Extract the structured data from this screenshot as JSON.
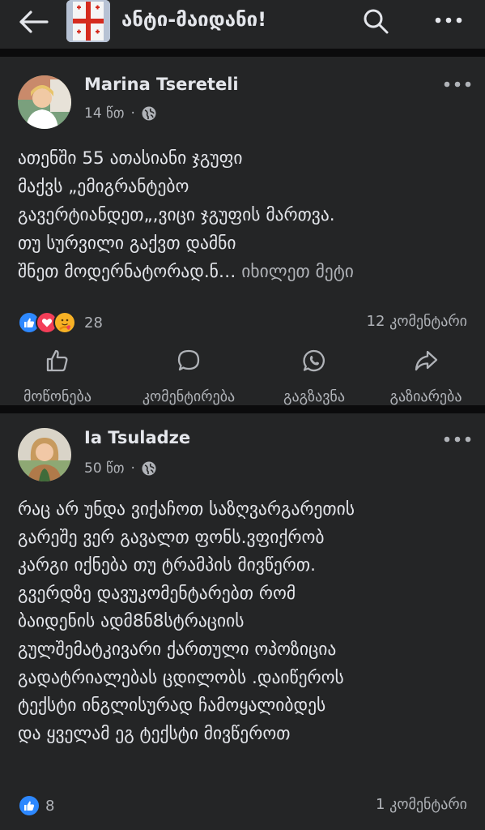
{
  "header": {
    "group_title": "ანტი-მაიდანი!",
    "back_icon": "arrow-left-icon",
    "search_icon": "search-icon",
    "more_icon": "more-horizontal-icon"
  },
  "posts": [
    {
      "author": "Marina Tsereteli",
      "time": "14 წთ",
      "visibility_icon": "globe-icon",
      "text": "ათენში 55 ათასიანი ჯგუფი\nმაქვს „ემიგრანტებო\nგავერტიანდეთ„,ვიცი ჯგუფის მართვა.\nთუ სურვილი გაქვთ დამნი\nშნეთ მოდერნატორად.ნ…",
      "see_more": " იხილეთ მეტი",
      "reactions": [
        "like",
        "love",
        "care"
      ],
      "reaction_count": "28",
      "comments": "12 კომენტარი",
      "actions": [
        {
          "label": "მოწონება",
          "icon": "thumbs-up-icon"
        },
        {
          "label": "კომენტირება",
          "icon": "comment-icon"
        },
        {
          "label": "გაგზავნა",
          "icon": "whatsapp-icon"
        },
        {
          "label": "გაზიარება",
          "icon": "share-icon"
        }
      ]
    },
    {
      "author": "Ia Tsuladze",
      "time": "50 წთ",
      "visibility_icon": "globe-icon",
      "text": "რაც არ უნდა ვიქაჩოთ საზღვარგარეთის\nგარეშე ვერ გავალთ ფონს.ვფიქრობ\nკარგი იქნება თუ ტრამპის მივწერთ.\nგვერდზე  დავუკომენტარებთ რომ\nბაიდენის ადმ8ნ8სტრაციის\nგულშემატკივარი ქართული ოპოზიცია\nგადატრიალებას ცდილობს .დაიწეროს\nტექსტი ინგლისურად ჩამოყალიბდეს\nდა ყველამ ეგ ტექსტი მივწეროთ",
      "reactions": [
        "like"
      ],
      "reaction_count": "8",
      "comments": "1 კომენტარი"
    }
  ],
  "colors": {
    "background": "#18191a",
    "card": "#242526",
    "text": "#e4e6eb",
    "muted": "#b0b3b8",
    "like": "#2d88ff",
    "love": "#f33e58",
    "care": "#f7b125"
  }
}
